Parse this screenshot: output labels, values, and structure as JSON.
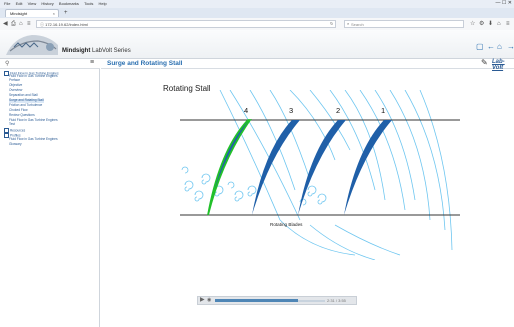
{
  "browser": {
    "menu_items": [
      "File",
      "Edit",
      "View",
      "History",
      "Bookmarks",
      "Tools",
      "Help"
    ],
    "window_controls": "— ☐ ✕",
    "tab_title": "Mindsight",
    "tab_close": "×",
    "new_tab": "+",
    "url": "ⓘ 172.16.19.62/index.html",
    "search_placeholder": "Search",
    "icons": [
      "back-icon",
      "forward-icon",
      "home-icon",
      "star-icon",
      "bookmark-icon",
      "download-icon",
      "menu-icon"
    ]
  },
  "banner": {
    "brand_bold": "Mindsight",
    "brand_rest": " LabVolt Series"
  },
  "sidebar": {
    "items": [
      {
        "label": "Fluid Flow in Gas Turbine Engines",
        "level": 0,
        "checkbox": true
      },
      {
        "label": "Fluid Flow in Gas Turbine Engines",
        "level": 1
      },
      {
        "label": "Preface",
        "level": 1
      },
      {
        "label": "Objective",
        "level": 1
      },
      {
        "label": "Overview",
        "level": 1
      },
      {
        "label": "Separation and Stall",
        "level": 1
      },
      {
        "label": "Surge and Rotating Stall",
        "level": 1,
        "selected": true
      },
      {
        "label": "Friction and Turbulence",
        "level": 1
      },
      {
        "label": "Choked Flow",
        "level": 1
      },
      {
        "label": "Review Questions",
        "level": 1
      },
      {
        "label": "Fluid Flow in Gas Turbine Engines",
        "level": 1
      },
      {
        "label": "Test",
        "level": 1
      },
      {
        "label": "Resources",
        "level": 0,
        "checkbox": true
      },
      {
        "label": "Profiles",
        "level": 0,
        "checkbox": true
      },
      {
        "label": "Fluid Flow in Gas Turbine Engines",
        "level": 1
      },
      {
        "label": "Glossary",
        "level": 1
      }
    ]
  },
  "content": {
    "title": "Surge and Rotating Stall",
    "logo_text": "Lab-Volt"
  },
  "slide": {
    "heading": "Rotating Stall",
    "blade_numbers": [
      "4",
      "3",
      "2",
      "1"
    ],
    "caption": "Rotating Blades",
    "colors": {
      "blade": "#1f5fa8",
      "stalled_edge": "#22c02a",
      "airflow": "#6ec6f0"
    }
  },
  "media": {
    "time": "2:31 / 3:55",
    "progress": 0.75
  }
}
